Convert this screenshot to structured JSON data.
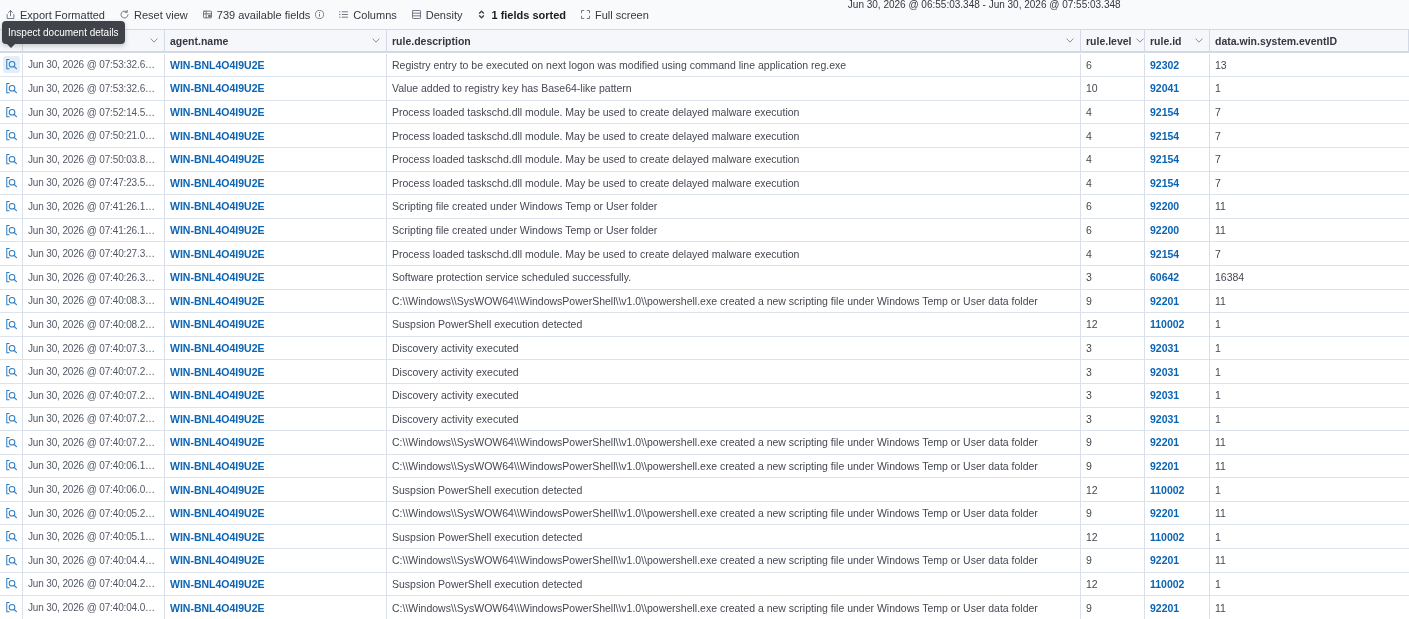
{
  "toolbar": {
    "items": [
      {
        "kind": "export",
        "label": "Export Formatted",
        "active": false,
        "info": false
      },
      {
        "kind": "reset",
        "label": "Reset view",
        "active": false,
        "info": false
      },
      {
        "kind": "fields",
        "label": "739 available fields",
        "active": false,
        "info": true
      },
      {
        "kind": "columns",
        "label": "Columns",
        "active": false,
        "info": false
      },
      {
        "kind": "density",
        "label": "Density",
        "active": false,
        "info": false
      },
      {
        "kind": "sort",
        "label": "1 fields sorted",
        "active": true,
        "info": false
      },
      {
        "kind": "fullscreen",
        "label": "Full screen",
        "active": false,
        "info": false
      }
    ],
    "time_range": "Jun 30, 2026 @ 06:55:03.348 - Jun 30, 2026 @ 07:55:03.348"
  },
  "tooltip": {
    "text": "Inspect document details"
  },
  "table": {
    "columns": [
      {
        "kind": "text",
        "menu": true
      },
      {
        "label": "agent.name",
        "kind": "link",
        "menu": true
      },
      {
        "label": "rule.description",
        "kind": "text",
        "menu": true
      },
      {
        "label": "rule.level",
        "kind": "text",
        "menu": true
      },
      {
        "label": "rule.id",
        "kind": "link",
        "menu": true
      },
      {
        "label": "data.win.system.eventID",
        "kind": "text",
        "menu": false
      }
    ],
    "rows": [
      {
        "hovered": true,
        "cells": [
          "Jun 30, 2026 @ 07:53:32.6…",
          "WIN-BNL4O4I9U2E",
          "Registry entry to be executed on next logon was modified using command line application reg.exe",
          "6",
          "92302",
          "13"
        ]
      },
      {
        "hovered": false,
        "cells": [
          "Jun 30, 2026 @ 07:53:32.6…",
          "WIN-BNL4O4I9U2E",
          "Value added to registry key has Base64-like pattern",
          "10",
          "92041",
          "1"
        ]
      },
      {
        "hovered": false,
        "cells": [
          "Jun 30, 2026 @ 07:52:14.5…",
          "WIN-BNL4O4I9U2E",
          "Process loaded taskschd.dll module. May be used to create delayed malware execution",
          "4",
          "92154",
          "7"
        ]
      },
      {
        "hovered": false,
        "cells": [
          "Jun 30, 2026 @ 07:50:21.0…",
          "WIN-BNL4O4I9U2E",
          "Process loaded taskschd.dll module. May be used to create delayed malware execution",
          "4",
          "92154",
          "7"
        ]
      },
      {
        "hovered": false,
        "cells": [
          "Jun 30, 2026 @ 07:50:03.8…",
          "WIN-BNL4O4I9U2E",
          "Process loaded taskschd.dll module. May be used to create delayed malware execution",
          "4",
          "92154",
          "7"
        ]
      },
      {
        "hovered": false,
        "cells": [
          "Jun 30, 2026 @ 07:47:23.5…",
          "WIN-BNL4O4I9U2E",
          "Process loaded taskschd.dll module. May be used to create delayed malware execution",
          "4",
          "92154",
          "7"
        ]
      },
      {
        "hovered": false,
        "cells": [
          "Jun 30, 2026 @ 07:41:26.1…",
          "WIN-BNL4O4I9U2E",
          "Scripting file created under Windows Temp or User folder",
          "6",
          "92200",
          "11"
        ]
      },
      {
        "hovered": false,
        "cells": [
          "Jun 30, 2026 @ 07:41:26.1…",
          "WIN-BNL4O4I9U2E",
          "Scripting file created under Windows Temp or User folder",
          "6",
          "92200",
          "11"
        ]
      },
      {
        "hovered": false,
        "cells": [
          "Jun 30, 2026 @ 07:40:27.3…",
          "WIN-BNL4O4I9U2E",
          "Process loaded taskschd.dll module. May be used to create delayed malware execution",
          "4",
          "92154",
          "7"
        ]
      },
      {
        "hovered": false,
        "cells": [
          "Jun 30, 2026 @ 07:40:26.3…",
          "WIN-BNL4O4I9U2E",
          "Software protection service scheduled successfully.",
          "3",
          "60642",
          "16384"
        ]
      },
      {
        "hovered": false,
        "cells": [
          "Jun 30, 2026 @ 07:40:08.3…",
          "WIN-BNL4O4I9U2E",
          "C:\\\\Windows\\\\SysWOW64\\\\WindowsPowerShell\\\\v1.0\\\\powershell.exe created a new scripting file under Windows Temp or User data folder",
          "9",
          "92201",
          "11"
        ]
      },
      {
        "hovered": false,
        "cells": [
          "Jun 30, 2026 @ 07:40:08.2…",
          "WIN-BNL4O4I9U2E",
          "Suspsion PowerShell execution detected",
          "12",
          "110002",
          "1"
        ]
      },
      {
        "hovered": false,
        "cells": [
          "Jun 30, 2026 @ 07:40:07.3…",
          "WIN-BNL4O4I9U2E",
          "Discovery activity executed",
          "3",
          "92031",
          "1"
        ]
      },
      {
        "hovered": false,
        "cells": [
          "Jun 30, 2026 @ 07:40:07.2…",
          "WIN-BNL4O4I9U2E",
          "Discovery activity executed",
          "3",
          "92031",
          "1"
        ]
      },
      {
        "hovered": false,
        "cells": [
          "Jun 30, 2026 @ 07:40:07.2…",
          "WIN-BNL4O4I9U2E",
          "Discovery activity executed",
          "3",
          "92031",
          "1"
        ]
      },
      {
        "hovered": false,
        "cells": [
          "Jun 30, 2026 @ 07:40:07.2…",
          "WIN-BNL4O4I9U2E",
          "Discovery activity executed",
          "3",
          "92031",
          "1"
        ]
      },
      {
        "hovered": false,
        "cells": [
          "Jun 30, 2026 @ 07:40:07.2…",
          "WIN-BNL4O4I9U2E",
          "C:\\\\Windows\\\\SysWOW64\\\\WindowsPowerShell\\\\v1.0\\\\powershell.exe created a new scripting file under Windows Temp or User data folder",
          "9",
          "92201",
          "11"
        ]
      },
      {
        "hovered": false,
        "cells": [
          "Jun 30, 2026 @ 07:40:06.1…",
          "WIN-BNL4O4I9U2E",
          "C:\\\\Windows\\\\SysWOW64\\\\WindowsPowerShell\\\\v1.0\\\\powershell.exe created a new scripting file under Windows Temp or User data folder",
          "9",
          "92201",
          "11"
        ]
      },
      {
        "hovered": false,
        "cells": [
          "Jun 30, 2026 @ 07:40:06.0…",
          "WIN-BNL4O4I9U2E",
          "Suspsion PowerShell execution detected",
          "12",
          "110002",
          "1"
        ]
      },
      {
        "hovered": false,
        "cells": [
          "Jun 30, 2026 @ 07:40:05.2…",
          "WIN-BNL4O4I9U2E",
          "C:\\\\Windows\\\\SysWOW64\\\\WindowsPowerShell\\\\v1.0\\\\powershell.exe created a new scripting file under Windows Temp or User data folder",
          "9",
          "92201",
          "11"
        ]
      },
      {
        "hovered": false,
        "cells": [
          "Jun 30, 2026 @ 07:40:05.1…",
          "WIN-BNL4O4I9U2E",
          "Suspsion PowerShell execution detected",
          "12",
          "110002",
          "1"
        ]
      },
      {
        "hovered": false,
        "cells": [
          "Jun 30, 2026 @ 07:40:04.4…",
          "WIN-BNL4O4I9U2E",
          "C:\\\\Windows\\\\SysWOW64\\\\WindowsPowerShell\\\\v1.0\\\\powershell.exe created a new scripting file under Windows Temp or User data folder",
          "9",
          "92201",
          "11"
        ]
      },
      {
        "hovered": false,
        "cells": [
          "Jun 30, 2026 @ 07:40:04.2…",
          "WIN-BNL4O4I9U2E",
          "Suspsion PowerShell execution detected",
          "12",
          "110002",
          "1"
        ]
      },
      {
        "hovered": false,
        "cells": [
          "Jun 30, 2026 @ 07:40:04.0…",
          "WIN-BNL4O4I9U2E",
          "C:\\\\Windows\\\\SysWOW64\\\\WindowsPowerShell\\\\v1.0\\\\powershell.exe created a new scripting file under Windows Temp or User data folder",
          "9",
          "92201",
          "11"
        ]
      }
    ]
  }
}
